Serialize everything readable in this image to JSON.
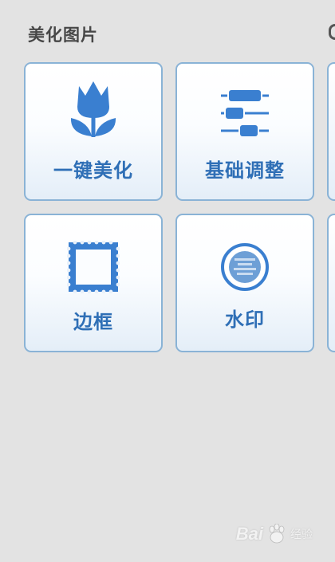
{
  "section": {
    "title": "美化图片"
  },
  "tiles": [
    {
      "label": "一键美化",
      "icon": "tulip-icon"
    },
    {
      "label": "基础调整",
      "icon": "sliders-icon"
    },
    {
      "label": "边框",
      "icon": "frame-icon"
    },
    {
      "label": "水印",
      "icon": "watermark-icon"
    }
  ],
  "watermark": {
    "brand": "Bai",
    "brand_suffix": "du",
    "sub": "经验"
  },
  "colors": {
    "accent": "#3a7fd0",
    "label": "#2f6fb6",
    "tile_border": "#8ab3d6",
    "background": "#e3e3e3",
    "title": "#474747"
  }
}
